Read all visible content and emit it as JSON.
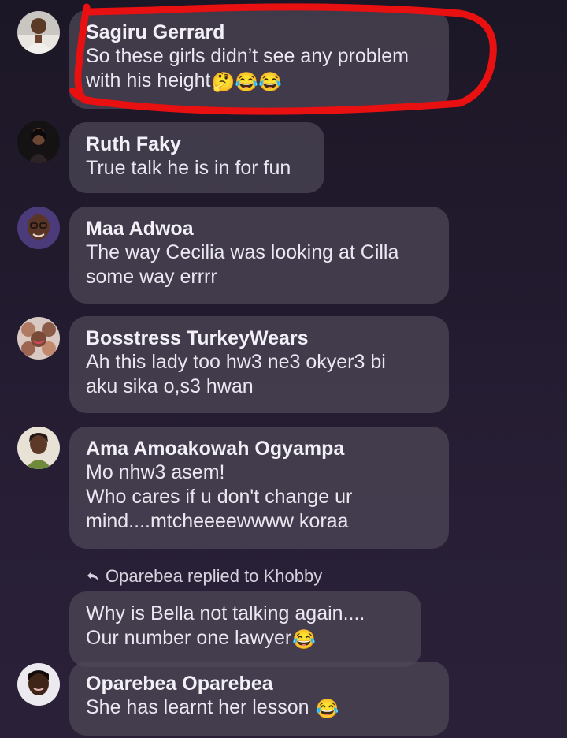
{
  "comments": [
    {
      "author": "Sagiru Gerrard",
      "text": "So these girls didn’t see any problem\nwith his height",
      "emoji": "🤔😂😂"
    },
    {
      "author": "Ruth Faky",
      "text": "True talk he is in for fun"
    },
    {
      "author": "Maa Adwoa",
      "text": "The way Cecilia was looking at Cilla\nsome way errrr"
    },
    {
      "author": "Bosstress TurkeyWears",
      "text": "Ah  this lady too hw3 ne3 okyer3 bi\naku sika o,s3 hwan"
    },
    {
      "author": "Ama Amoakowah Ogyampa",
      "text": "Mo nhw3 asem!\nWho cares if u don't change ur\nmind....mtcheeeewwww koraa"
    }
  ],
  "reply_thread": {
    "label": "Oparebea replied to Khobby",
    "icon": "reply-arrow-icon",
    "text": "Why is Bella not talking again....\nOur number one lawyer",
    "emoji": "😂"
  },
  "last_comment": {
    "author": "Oparebea Oparebea",
    "text": "She has learnt her lesson",
    "emoji": "😂"
  },
  "colors": {
    "highlight": "#e81010",
    "bubble": "#4e4858",
    "background": "#211a2d"
  }
}
